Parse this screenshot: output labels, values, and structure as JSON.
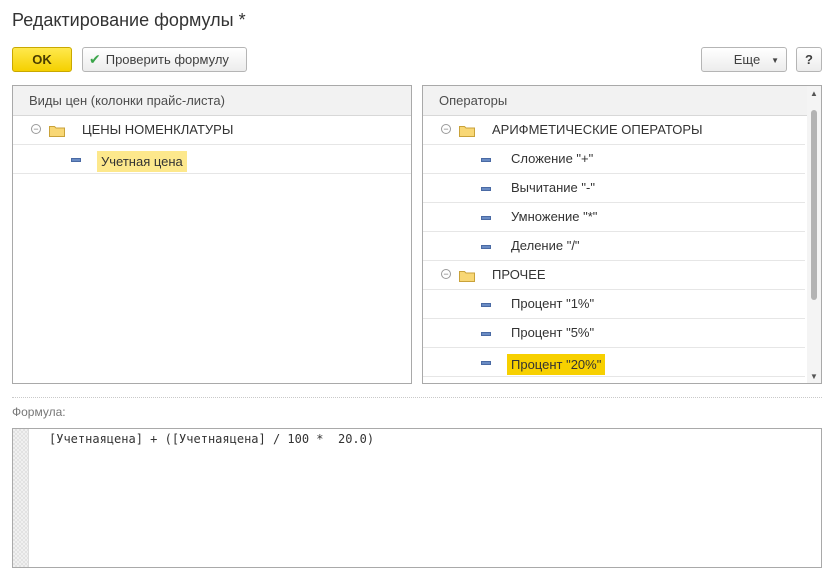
{
  "window": {
    "title": "Редактирование формулы *"
  },
  "toolbar": {
    "ok_label": "OK",
    "check_label": "Проверить формулу",
    "more_label": "Еще",
    "help_label": "?"
  },
  "price_types": {
    "header": "Виды цен (колонки прайс-листа)",
    "group": {
      "label": "ЦЕНЫ НОМЕНКЛАТУРЫ"
    },
    "items": [
      {
        "label": "Учетная цена"
      }
    ]
  },
  "operators": {
    "header": "Операторы",
    "groups": [
      {
        "label": "АРИФМЕТИЧЕСКИЕ ОПЕРАТОРЫ",
        "items": [
          {
            "label": "Сложение \"+\""
          },
          {
            "label": "Вычитание \"-\""
          },
          {
            "label": "Умножение \"*\""
          },
          {
            "label": "Деление \"/\""
          }
        ]
      },
      {
        "label": "ПРОЧЕЕ",
        "items": [
          {
            "label": "Процент \"1%\""
          },
          {
            "label": "Процент \"5%\""
          },
          {
            "label": "Процент \"20%\""
          }
        ]
      }
    ]
  },
  "formula": {
    "label": "Формула:",
    "value": "[Учетнаяцена] + ([Учетнаяцена] / 100 *  20.0)"
  },
  "colors": {
    "ok_button": "#f5d000",
    "selected_row": "#f7d000",
    "current_row": "#fde88c",
    "check_icon": "#3aa54a"
  }
}
